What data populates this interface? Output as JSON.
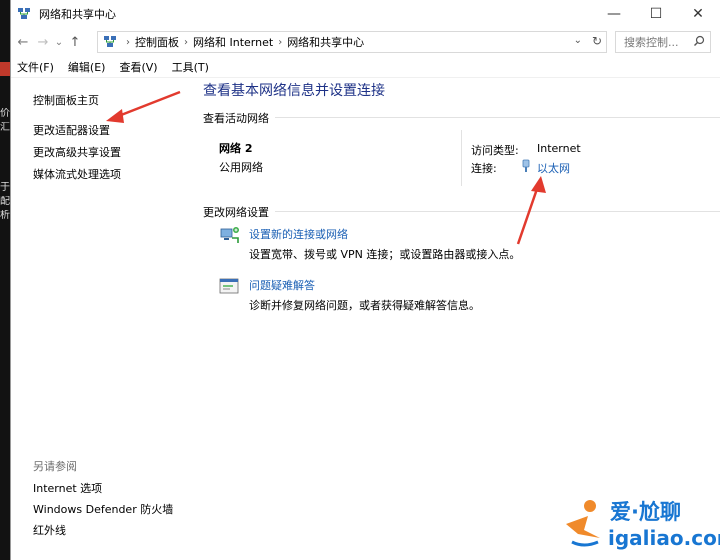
{
  "window": {
    "title": "网络和共享中心",
    "controls": {
      "minimize": "—",
      "maximize": "☐",
      "close": "✕"
    }
  },
  "nav": {
    "back": "←",
    "forward": "→",
    "dropdown": "⌄",
    "up": "↑",
    "breadcrumbs": [
      "控制面板",
      "网络和 Internet",
      "网络和共享中心"
    ],
    "crumb_sep": "›",
    "address_dropdown": "⌄",
    "refresh": "↻",
    "search_placeholder": "搜索控制..."
  },
  "menubar": {
    "items": [
      "文件(F)",
      "编辑(E)",
      "查看(V)",
      "工具(T)"
    ]
  },
  "sidebar": {
    "links": [
      "控制面板主页",
      "更改适配器设置",
      "更改高级共享设置",
      "媒体流式处理选项"
    ],
    "see_also_label": "另请参阅",
    "see_also": [
      "Internet 选项",
      "Windows Defender 防火墙",
      "红外线"
    ]
  },
  "main": {
    "heading": "查看基本网络信息并设置连接",
    "active_networks_label": "查看活动网络",
    "network": {
      "name": "网络 2",
      "kind": "公用网络",
      "access_type_label": "访问类型:",
      "access_type_value": "Internet",
      "connections_label": "连接:",
      "connections_value": "以太网"
    },
    "change_settings_label": "更改网络设置",
    "tasks": [
      {
        "link": "设置新的连接或网络",
        "desc": "设置宽带、拨号或 VPN 连接；或设置路由器或接入点。",
        "icon": "new-connection-icon"
      },
      {
        "link": "问题疑难解答",
        "desc": "诊断并修复网络问题，或者获得疑难解答信息。",
        "icon": "troubleshoot-icon"
      }
    ]
  },
  "desktop": {
    "fragments": [
      "价",
      "汇",
      "于",
      "配",
      "析"
    ]
  },
  "watermark": {
    "line1": "爱·尬聊",
    "line2": "igaliao.com"
  },
  "colors": {
    "link": "#1a5fb4",
    "heading": "#1e3287",
    "annotation": "#e23a2e"
  }
}
